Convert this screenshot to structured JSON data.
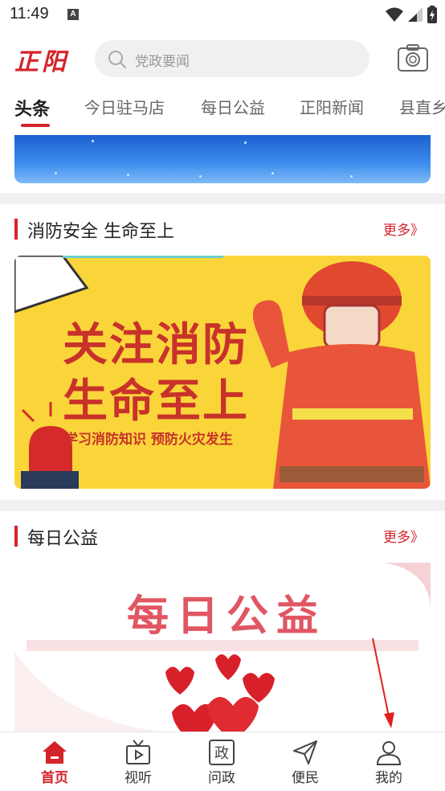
{
  "status_bar": {
    "time": "11:49",
    "notification_badge": "A"
  },
  "header": {
    "logo_text": "正阳",
    "search_placeholder": "党政要闻",
    "brand_color": "#d4232a"
  },
  "tabs": [
    {
      "label": "头条",
      "active": true
    },
    {
      "label": "今日驻马店",
      "active": false
    },
    {
      "label": "每日公益",
      "active": false
    },
    {
      "label": "正阳新闻",
      "active": false
    },
    {
      "label": "县直乡",
      "active": false
    }
  ],
  "sections": {
    "fire_safety": {
      "title": "消防安全 生命至上",
      "more": "更多》",
      "image_text_line1": "关注消防",
      "image_text_line2": "生命至上",
      "image_subtext": "学习消防知识 预防火灾发生"
    },
    "daily_charity": {
      "title": "每日公益",
      "more": "更多》",
      "image_text": "每日公益"
    }
  },
  "bottom_nav": [
    {
      "label": "首页",
      "icon": "home-icon",
      "active": true
    },
    {
      "label": "视听",
      "icon": "tv-icon",
      "active": false
    },
    {
      "label": "问政",
      "icon": "politics-icon",
      "active": false
    },
    {
      "label": "便民",
      "icon": "send-icon",
      "active": false
    },
    {
      "label": "我的",
      "icon": "user-icon",
      "active": false
    }
  ]
}
